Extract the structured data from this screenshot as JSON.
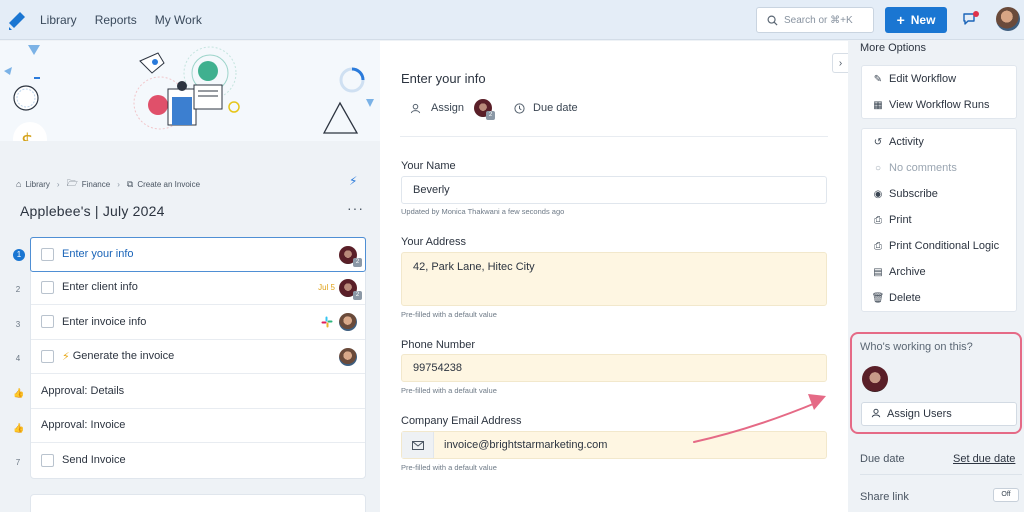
{
  "nav": {
    "links": [
      "Library",
      "Reports",
      "My Work"
    ],
    "search_placeholder": "Search or ⌘+K",
    "new_label": "New"
  },
  "breadcrumb": [
    "Library",
    "Finance",
    "Create an Invoice"
  ],
  "workflow_title": "Applebee's | July 2024",
  "steps": [
    {
      "num": "1",
      "label": "Enter your info",
      "active": true
    },
    {
      "num": "2",
      "label": "Enter client info",
      "due": "Jul 5"
    },
    {
      "num": "3",
      "label": "Enter invoice info"
    },
    {
      "num": "4",
      "label": "Generate the invoice"
    },
    {
      "label": "Approval: Details"
    },
    {
      "label": "Approval: Invoice"
    },
    {
      "num": "7",
      "label": "Send Invoice"
    }
  ],
  "form": {
    "title": "Enter your info",
    "assign_label": "Assign",
    "due_label": "Due date",
    "fields": [
      {
        "label": "Your Name",
        "value": "Beverly",
        "note": "Updated by Monica Thakwani a few seconds ago"
      },
      {
        "label": "Your Address",
        "value": "42, Park Lane, Hitec City",
        "note": "Pre-filled with a default value"
      },
      {
        "label": "Phone Number",
        "value": "99754238",
        "note": "Pre-filled with a default value"
      },
      {
        "label": "Company Email Address",
        "value": "invoice@brightstarmarketing.com",
        "note": "Pre-filled with a default value"
      }
    ]
  },
  "right": {
    "more_options": "More Options",
    "options_group1": [
      "Edit Workflow",
      "View Workflow Runs"
    ],
    "options_group2": [
      "Activity",
      "No comments",
      "Subscribe",
      "Print",
      "Print Conditional Logic",
      "Archive",
      "Delete"
    ],
    "who_title": "Who's working on this?",
    "assign_users": "Assign Users",
    "due_date": "Due date",
    "set_due_date": "Set due date",
    "share_link": "Share link",
    "toggle_off": "Off"
  },
  "colors": {
    "accent": "#1a76d2",
    "highlight": "#e56a86",
    "prefill": "#fef6e2"
  }
}
